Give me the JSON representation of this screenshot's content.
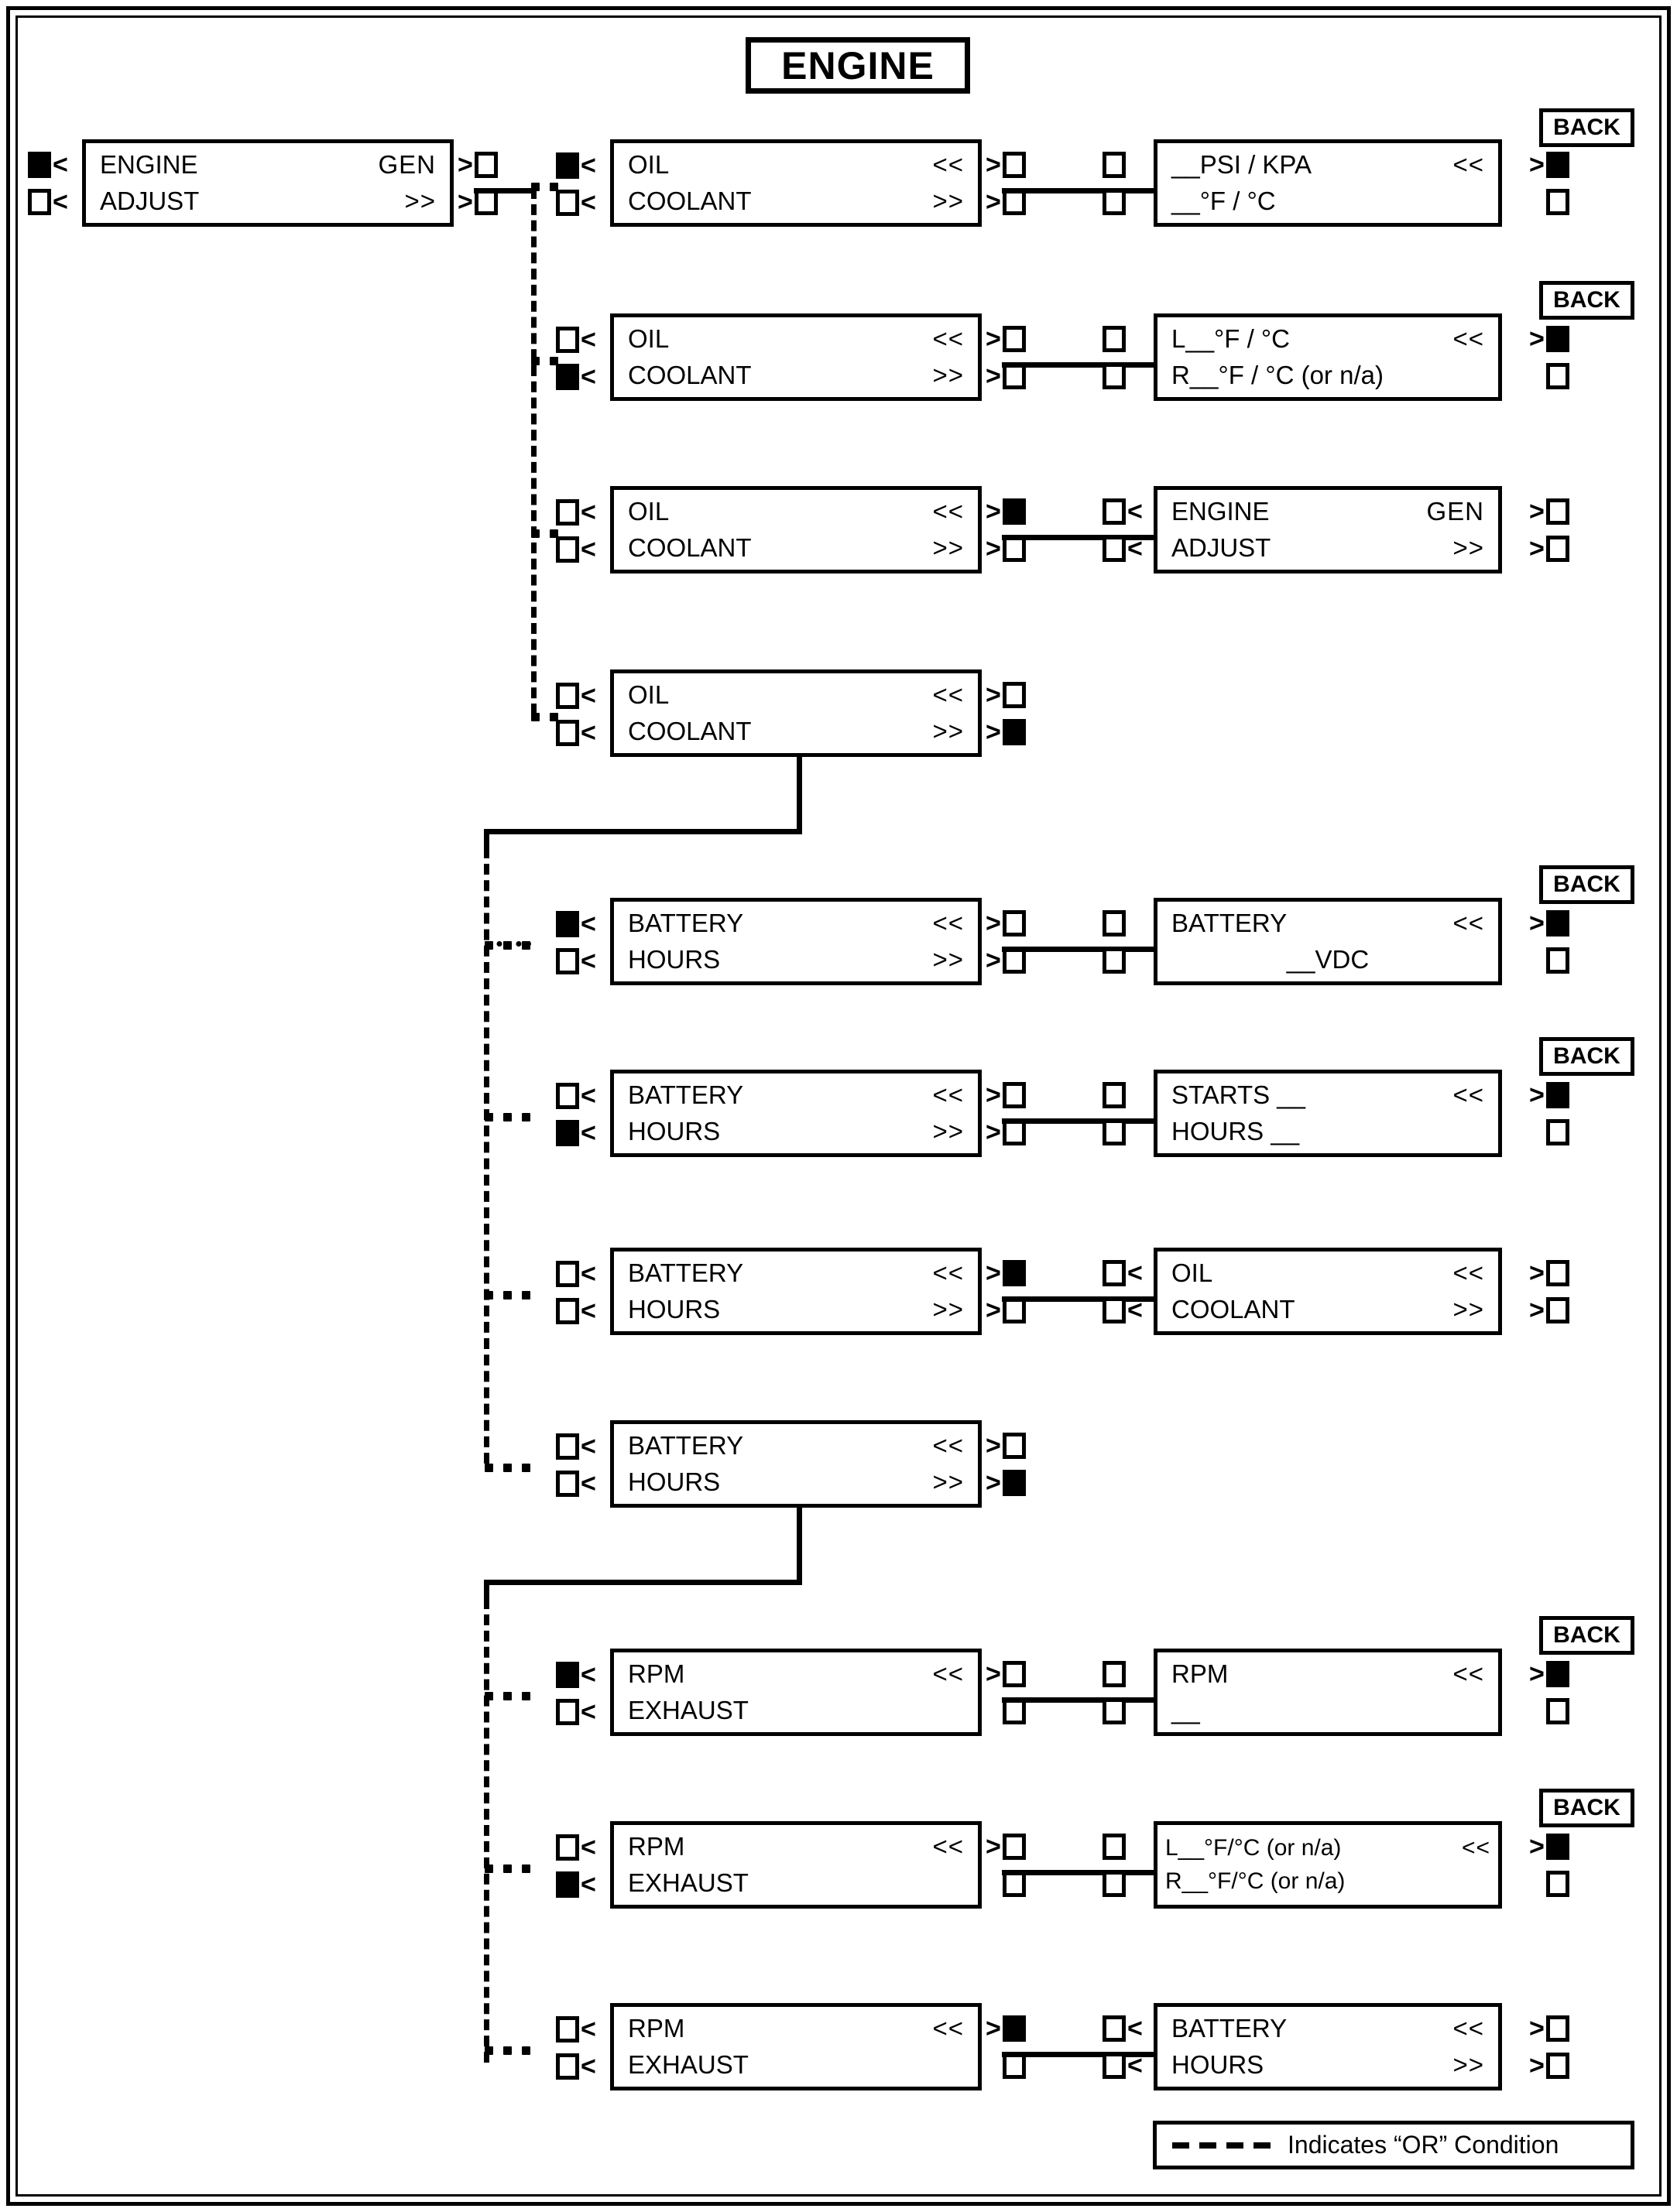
{
  "title": {
    "text": "ENGINE"
  },
  "legend": {
    "text": "Indicates “OR” Condition",
    "dash_symbol": "- - - -"
  },
  "labels": {
    "back": "BACK",
    "chevron_left": "<",
    "chevron_right": ">"
  },
  "root_panel": {
    "line1_left": "ENGINE",
    "line1_right": "GEN",
    "line2_left": "ADJUST",
    "line2_right": ">>",
    "left_buttons": [
      "filled",
      "empty"
    ],
    "right_buttons": [
      "empty",
      "empty"
    ]
  },
  "rows": [
    {
      "id": "oil-coolant-1",
      "left_buttons": [
        "filled",
        "empty"
      ],
      "source": {
        "line1_left": "OIL",
        "line1_right": "<<",
        "line2_left": "COOLANT",
        "line2_right": ">>"
      },
      "mid_buttons": [
        "empty",
        "empty"
      ],
      "dest_buttons": [
        "empty",
        "empty"
      ],
      "dest": {
        "line1_left": "__PSI / KPA",
        "line1_right": "<<",
        "line2_left": "__°F /  °C",
        "line2_right": ""
      },
      "dest_right_buttons": [
        "filled",
        "empty"
      ],
      "back": true
    },
    {
      "id": "oil-coolant-2",
      "left_buttons": [
        "empty",
        "filled"
      ],
      "source": {
        "line1_left": "OIL",
        "line1_right": "<<",
        "line2_left": "COOLANT",
        "line2_right": ">>"
      },
      "mid_buttons": [
        "empty",
        "empty"
      ],
      "dest_buttons": [
        "empty",
        "empty"
      ],
      "dest": {
        "line1_left": "L__°F /  °C",
        "line1_right": "<<",
        "line2_left": "R__°F /  °C  (or n/a)",
        "line2_right": ""
      },
      "dest_right_buttons": [
        "filled",
        "empty"
      ],
      "back": true
    },
    {
      "id": "oil-coolant-3",
      "left_buttons": [
        "empty",
        "empty"
      ],
      "source": {
        "line1_left": "OIL",
        "line1_right": "<<",
        "line2_left": "COOLANT",
        "line2_right": ">>"
      },
      "mid_buttons": [
        "filled",
        "empty"
      ],
      "dest_buttons": [
        "empty",
        "empty"
      ],
      "dest": {
        "line1_left": "ENGINE",
        "line1_right": "GEN",
        "line2_left": "ADJUST",
        "line2_right": ">>"
      },
      "dest_right_buttons": [
        "empty",
        "empty"
      ],
      "back": false
    },
    {
      "id": "oil-coolant-4",
      "left_buttons": [
        "empty",
        "empty"
      ],
      "source": {
        "line1_left": "OIL",
        "line1_right": "<<",
        "line2_left": "COOLANT",
        "line2_right": ">>"
      },
      "mid_buttons": [
        "empty",
        "filled"
      ],
      "dest": null,
      "back": false
    },
    {
      "id": "battery-hours-1",
      "left_buttons": [
        "filled",
        "empty"
      ],
      "source": {
        "line1_left": "BATTERY",
        "line1_right": "<<",
        "line2_left": "HOURS",
        "line2_right": ">>"
      },
      "mid_buttons": [
        "empty",
        "empty"
      ],
      "dest_buttons": [
        "empty",
        "empty"
      ],
      "dest": {
        "line1_left": "BATTERY",
        "line1_right": "<<",
        "line2_left": "__VDC",
        "line2_right": ""
      },
      "dest_right_buttons": [
        "filled",
        "empty"
      ],
      "back": true
    },
    {
      "id": "battery-hours-2",
      "left_buttons": [
        "empty",
        "filled"
      ],
      "source": {
        "line1_left": "BATTERY",
        "line1_right": "<<",
        "line2_left": "HOURS",
        "line2_right": ">>"
      },
      "mid_buttons": [
        "empty",
        "empty"
      ],
      "dest_buttons": [
        "empty",
        "empty"
      ],
      "dest": {
        "line1_left": "STARTS __",
        "line1_right": "<<",
        "line2_left": "HOURS __",
        "line2_right": ""
      },
      "dest_right_buttons": [
        "filled",
        "empty"
      ],
      "back": true
    },
    {
      "id": "battery-hours-3",
      "left_buttons": [
        "empty",
        "empty"
      ],
      "source": {
        "line1_left": "BATTERY",
        "line1_right": "<<",
        "line2_left": "HOURS",
        "line2_right": ">>"
      },
      "mid_buttons": [
        "filled",
        "empty"
      ],
      "dest_buttons": [
        "empty",
        "empty"
      ],
      "dest": {
        "line1_left": "OIL",
        "line1_right": "<<",
        "line2_left": "COOLANT",
        "line2_right": ">>"
      },
      "dest_right_buttons": [
        "empty",
        "empty"
      ],
      "back": false
    },
    {
      "id": "battery-hours-4",
      "left_buttons": [
        "empty",
        "empty"
      ],
      "source": {
        "line1_left": "BATTERY",
        "line1_right": "<<",
        "line2_left": "HOURS",
        "line2_right": ">>"
      },
      "mid_buttons": [
        "empty",
        "filled"
      ],
      "dest": null,
      "back": false
    },
    {
      "id": "rpm-exhaust-1",
      "left_buttons": [
        "filled",
        "empty"
      ],
      "source": {
        "line1_left": "RPM",
        "line1_right": "<<",
        "line2_left": "EXHAUST",
        "line2_right": ""
      },
      "mid_buttons": [
        "empty",
        "empty"
      ],
      "dest_buttons": [
        "empty",
        "empty"
      ],
      "dest": {
        "line1_left": "RPM",
        "line1_right": "<<",
        "line2_left": "__",
        "line2_right": ""
      },
      "dest_right_buttons": [
        "filled",
        "empty"
      ],
      "back": true
    },
    {
      "id": "rpm-exhaust-2",
      "left_buttons": [
        "empty",
        "filled"
      ],
      "source": {
        "line1_left": "RPM",
        "line1_right": "<<",
        "line2_left": "EXHAUST",
        "line2_right": ""
      },
      "mid_buttons": [
        "empty",
        "empty"
      ],
      "dest_buttons": [
        "empty",
        "empty"
      ],
      "dest": {
        "line1_left": "L__°F/°C (or n/a)",
        "line1_right": "<<",
        "line2_left": "R__°F/°C (or n/a)",
        "line2_right": ""
      },
      "dest_right_buttons": [
        "filled",
        "empty"
      ],
      "back": true
    },
    {
      "id": "rpm-exhaust-3",
      "left_buttons": [
        "empty",
        "empty"
      ],
      "source": {
        "line1_left": "RPM",
        "line1_right": "<<",
        "line2_left": "EXHAUST",
        "line2_right": ""
      },
      "mid_buttons": [
        "filled",
        "empty"
      ],
      "dest_buttons": [
        "empty",
        "empty"
      ],
      "dest": {
        "line1_left": "BATTERY",
        "line1_right": "<<",
        "line2_left": "HOURS",
        "line2_right": ">>"
      },
      "dest_right_buttons": [
        "empty",
        "empty"
      ],
      "back": false
    }
  ]
}
